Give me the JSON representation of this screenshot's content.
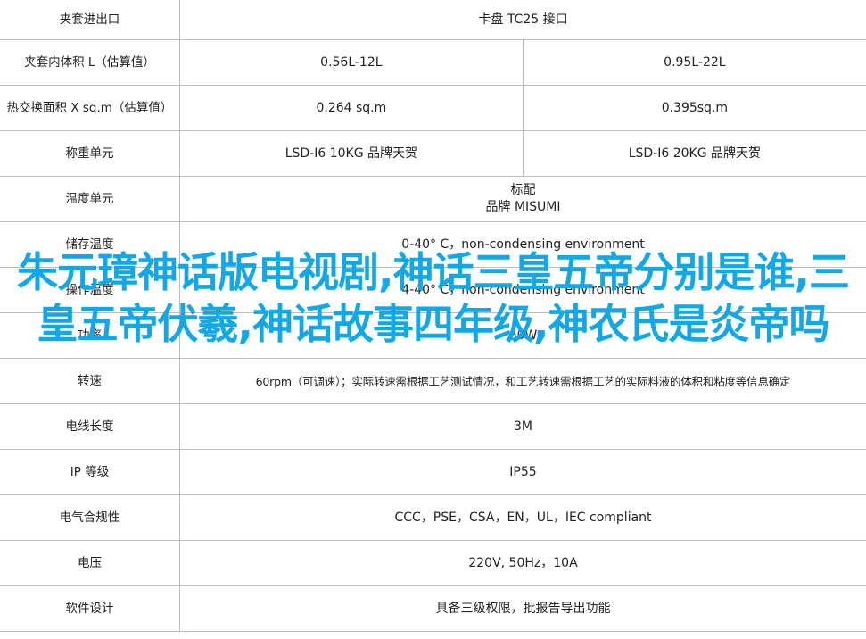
{
  "spec_rows": [
    {
      "label": "夹套进出口",
      "col1": "卡盘 TC25 接口",
      "merged": true
    },
    {
      "label": "夹套内体积 L（估算值）",
      "col1": "0.56L-12L",
      "col2": "0.95L-22L"
    },
    {
      "label": "热交换面积 X sq.m（估算值）",
      "col1": "0.264 sq.m",
      "col2": "0.395sq.m"
    },
    {
      "label": "称重单元",
      "col1": "LSD-I6 10KG 品牌天贺",
      "col2": "LSD-I6 20KG 品牌天贺"
    },
    {
      "label": "温度单元",
      "col1": "标配",
      "col1b": "品牌 MISUMI",
      "merged": true
    },
    {
      "label": "储存温度",
      "col1": "0-40° C，non-condensing environment",
      "merged": true
    },
    {
      "label": "操作温度",
      "col1": "4-40° C，non-condensing environment",
      "merged": true
    },
    {
      "label": "功率",
      "col1": "60W",
      "merged": true
    },
    {
      "label": "转速",
      "col1": "60rpm（可调速）；实际转速需根据工艺测试情况，和工艺转速需根据工艺的实际料液的体积和粘度等信息确定",
      "merged": true,
      "small": true
    },
    {
      "label": "电线长度",
      "col1": "3M",
      "merged": true
    },
    {
      "label": "IP 等级",
      "col1": "IP55",
      "merged": true
    },
    {
      "label": "电气合规性",
      "col1": "CCC，PSE，CSA，EN，UL，IEC compliant",
      "merged": true
    },
    {
      "label": "电压",
      "col1": "220V, 50Hz，10A",
      "merged": true
    },
    {
      "label": "软件设计",
      "col1": "具备三级权限，批报告导出功能",
      "merged": true
    }
  ],
  "headline": "朱元璋神话版电视剧,神话三皇五帝分别是谁,三皇五帝伏羲,神话故事四年级,神农氏是炎帝吗",
  "colors": {
    "headline": "#12a8e8",
    "border": "#bdbdbd",
    "text": "#222222"
  }
}
